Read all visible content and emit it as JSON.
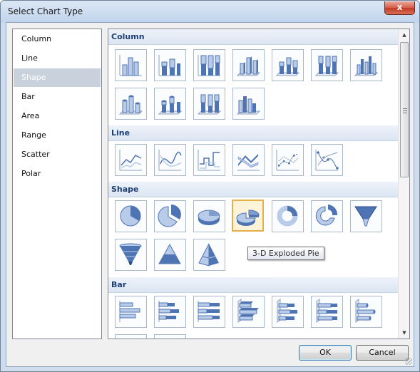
{
  "window": {
    "title": "Select Chart Type",
    "close_glyph": "x"
  },
  "left_list": {
    "items": [
      "Column",
      "Line",
      "Shape",
      "Bar",
      "Area",
      "Range",
      "Scatter",
      "Polar"
    ],
    "selected": "Shape"
  },
  "gallery": {
    "sections": [
      {
        "name": "Column",
        "icons": [
          "column-chart-icon",
          "stacked-column-chart-icon",
          "stacked-100-column-chart-icon",
          "3d-column-chart-icon",
          "3d-stacked-column-chart-icon",
          "3d-stacked-100-column-chart-icon",
          "3d-clustered-column-chart-icon",
          "cylinder-column-chart-icon",
          "stacked-cylinder-chart-icon",
          "stacked-100-cylinder-chart-icon",
          "3d-cylinder-chart-icon"
        ]
      },
      {
        "name": "Line",
        "icons": [
          "line-chart-icon",
          "spline-chart-icon",
          "step-line-chart-icon",
          "3d-line-chart-icon",
          "line-markers-chart-icon",
          "spline-markers-chart-icon"
        ]
      },
      {
        "name": "Shape",
        "icons": [
          "pie-chart-icon",
          "exploded-pie-chart-icon",
          "3d-pie-chart-icon",
          "3d-exploded-pie-chart-icon",
          "doughnut-chart-icon",
          "exploded-doughnut-chart-icon",
          "funnel-chart-icon",
          "3d-funnel-chart-icon",
          "pyramid-chart-icon",
          "3d-pyramid-chart-icon"
        ]
      },
      {
        "name": "Bar",
        "icons": [
          "bar-chart-icon",
          "stacked-bar-chart-icon",
          "stacked-100-bar-chart-icon",
          "3d-bar-chart-icon",
          "3d-stacked-bar-chart-icon",
          "3d-stacked-100-bar-chart-icon",
          "3d-cylinder-bar-chart-icon"
        ]
      }
    ],
    "hovered_icon": "3d-exploded-pie-chart-icon",
    "tooltip": "3-D Exploded Pie"
  },
  "buttons": {
    "ok": "OK",
    "cancel": "Cancel"
  },
  "scrollbar": {
    "up_glyph": "▲",
    "down_glyph": "▼"
  },
  "colors": {
    "title_bg": "#c2d5ec",
    "close_red": "#c23b25",
    "section_text": "#1e3f75",
    "hover_border": "#e3b04b",
    "chart_blue": "#4f74b3",
    "chart_light": "#b8cbe9"
  }
}
